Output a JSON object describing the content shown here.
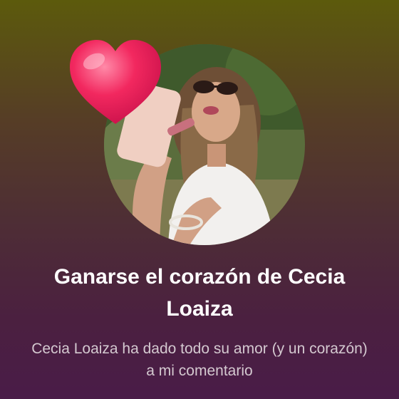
{
  "notification": {
    "title": "Ganarse el corazón de Cecia Loaiza",
    "message": "Cecia Loaiza ha dado todo su amor (y un corazón) a mi comentario"
  },
  "icons": {
    "heart": "heart-icon",
    "avatar": "profile-photo"
  },
  "colors": {
    "gradient_top": "#5c5a0c",
    "gradient_bottom": "#4a1c48",
    "heart": "#f0195c",
    "title": "#ffffff",
    "message": "#d4c9d0"
  }
}
